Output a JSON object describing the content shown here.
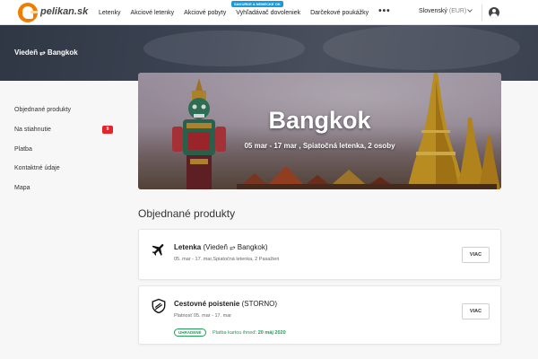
{
  "brand": {
    "logo_text": "pelikan.sk"
  },
  "nav": {
    "items": [
      "Letenky",
      "Akciové letenky",
      "Akciové pobyty",
      "Vyhľadávač dovoleniek",
      "Darčekové poukážky"
    ],
    "badge": "SAKURKE A NEMECKE OK",
    "more": "•••"
  },
  "header": {
    "language": "Slovenský",
    "currency": "(EUR)"
  },
  "route": {
    "title": "Viedeň ⥂ Bangkok"
  },
  "sidebar": {
    "items": [
      "Objednané produkty",
      "Na stiahnutie",
      "Platba",
      "Kontaktné údaje",
      "Mapa"
    ],
    "download_count": "9"
  },
  "banner": {
    "city": "Bangkok",
    "trip": "05 mar - 17 mar , Spiatočná letenka, 2 osoby"
  },
  "products": {
    "heading": "Objednané produkty",
    "items": [
      {
        "title": "Letenka",
        "title_detail": "(Viedeň ⥂ Bangkok)",
        "subtitle": "05. mar - 17. mar,Spiatočná letenka, 2 Pasažieri",
        "button": "VIAC"
      },
      {
        "title": "Cestovné poistenie",
        "title_detail": "(STORNO)",
        "subtitle": "Platnosť 05. mar - 17. mar",
        "paid_badge": "UHRADENÉ",
        "pay_text": "Platba kartou ihneď:",
        "pay_date": "20 máj 2020",
        "button": "VIAC"
      }
    ]
  },
  "colors": {
    "brand_orange": "#f07d00",
    "alert_red": "#e8222a",
    "paid_green": "#1f9d55",
    "nav_badge_blue": "#1a9bd7"
  }
}
